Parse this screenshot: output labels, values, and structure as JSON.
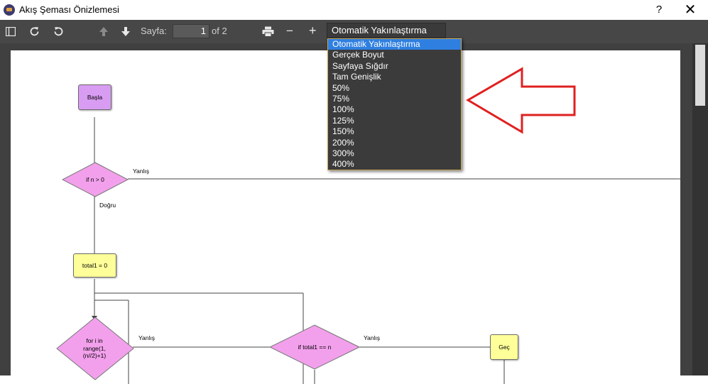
{
  "window": {
    "title": "Akış Şeması Önizlemesi",
    "help_label": "?",
    "close_label": "✕"
  },
  "toolbar": {
    "page_label": "Sayfa:",
    "page_value": "1",
    "page_total": "of 2",
    "zoom_label": "−",
    "zoom_in_label": "+",
    "zoom_selected": "Otomatik Yakınlaştırma",
    "icons": [
      "sidebar-toggle-icon",
      "refresh-icon",
      "rotate-icon",
      "arrow-up-icon",
      "arrow-down-icon",
      "print-icon"
    ]
  },
  "zoom_options": [
    "Otomatik Yakınlaştırma",
    "Gerçek Boyut",
    "Sayfaya Sığdır",
    "Tam Genişlik",
    "50%",
    "75%",
    "100%",
    "125%",
    "150%",
    "200%",
    "300%",
    "400%"
  ],
  "flowchart": {
    "start": "Başla",
    "cond1": "if n > 0",
    "assign": "total1 = 0",
    "loop": "for i in range(1, (n//2)+1)",
    "cond2": "if total1 == n",
    "pass": "Geç",
    "false_label": "Yanlış",
    "true_label": "Doğru",
    "false_label_2": "Yanlış",
    "false_label_3": "Yanlış",
    "colors": {
      "start": "#d89cf2",
      "decision": "#f2a0ec",
      "process": "#ffff99"
    }
  },
  "annotation": {
    "arrow_color": "#e02020"
  }
}
